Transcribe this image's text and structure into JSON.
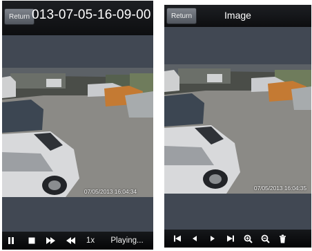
{
  "playback_screen": {
    "return_label": "Return",
    "title": "013-07-05-16-09-00",
    "timestamp": "07/05/2013 16:04:34",
    "controls": {
      "pause": "pause-icon",
      "stop": "stop-icon",
      "fast_forward": "fast-forward-icon",
      "rewind": "rewind-icon",
      "speed_label": "1x",
      "status_label": "Playing..."
    }
  },
  "image_screen": {
    "return_label": "Return",
    "title": "Image",
    "timestamp": "07/05/2013 16:04:35",
    "controls": {
      "first": "skip-first-icon",
      "previous": "previous-icon",
      "next": "next-icon",
      "last": "skip-last-icon",
      "zoom_in": "zoom-in-icon",
      "zoom_out": "zoom-out-icon",
      "delete": "trash-icon"
    }
  },
  "colors": {
    "phone_background": "#414853",
    "bar_background": "#0d0e10",
    "text": "#ffffff"
  }
}
